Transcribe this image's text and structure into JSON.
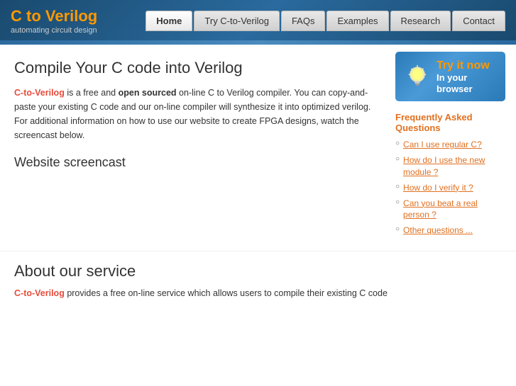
{
  "site": {
    "title": "C to Verilog",
    "subtitle": "automating circuit design"
  },
  "nav": {
    "items": [
      {
        "label": "Home",
        "active": true
      },
      {
        "label": "Try C-to-Verilog",
        "active": false
      },
      {
        "label": "FAQs",
        "active": false
      },
      {
        "label": "Examples",
        "active": false
      },
      {
        "label": "Research",
        "active": false
      },
      {
        "label": "Contact",
        "active": false
      }
    ]
  },
  "main": {
    "page_title": "Compile Your C code into Verilog",
    "intro_brand": "C-to-Verilog",
    "intro_text_1": " is a free and ",
    "intro_bold": "open sourced",
    "intro_text_2": " on-line C to Verilog compiler. You can copy-and-paste your existing C code and our on-line compiler will synthesize it into optimized verilog. For additional information on how to use our website to create FPGA designs, watch the screencast below.",
    "screencast_title": "Website screencast"
  },
  "sidebar": {
    "try_now_line1": "Try it now",
    "try_now_line2": "In your browser",
    "faq_title": "Frequently Asked Questions",
    "faq_items": [
      {
        "text": "Can I use regular C?"
      },
      {
        "text": "How do I use the new module ?"
      },
      {
        "text": "How do I verify it ?"
      },
      {
        "text": "Can you beat a real person ?"
      },
      {
        "text": "Other questions ..."
      }
    ]
  },
  "bottom": {
    "about_title": "About our service",
    "about_brand": "C-to-Verilog",
    "about_text": " provides a free on-line service which allows users to compile their existing C code"
  }
}
